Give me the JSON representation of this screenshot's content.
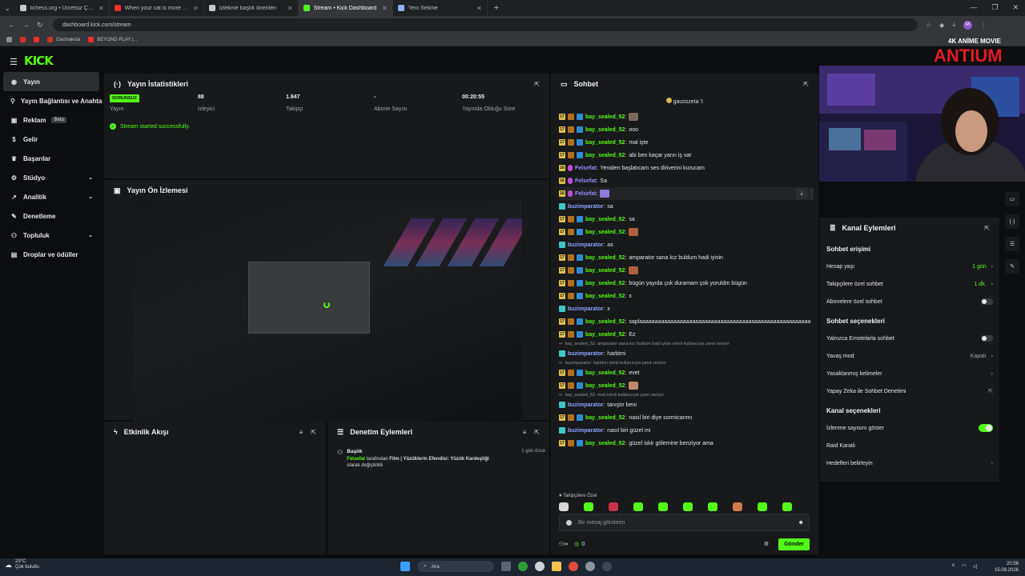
{
  "browser": {
    "tabs": [
      {
        "label": "lichess.org • Ücretsiz Çevrimiçi",
        "color": "#c9c9c9",
        "active": false
      },
      {
        "label": "When your cat is more polite th",
        "color": "#ff2e2e",
        "active": false
      },
      {
        "label": "İzlekme başlık önerileri",
        "color": "#c9c9c9",
        "active": false
      },
      {
        "label": "Stream • Kick Dashboard",
        "color": "#53fc18",
        "active": true
      },
      {
        "label": "Yeni Sekme",
        "color": "#8ab4f8",
        "active": false
      }
    ],
    "url": "dashboard.kick.com/stream",
    "bookmarks": [
      "Gachiakuta",
      "BEYOND PLAY |..."
    ]
  },
  "brand": {
    "logo": "KICK",
    "accent": "#53fc18"
  },
  "sidebar": {
    "items": [
      {
        "label": "Yayın",
        "icon": "broadcast-icon",
        "active": true
      },
      {
        "label": "Yayın Bağlantısı ve Anahtarı",
        "icon": "link-icon"
      },
      {
        "label": "Reklam",
        "icon": "ad-icon",
        "badge": "Beta"
      },
      {
        "label": "Gelir",
        "icon": "money-icon"
      },
      {
        "label": "Başarılar",
        "icon": "trophy-icon"
      },
      {
        "label": "Stüdyo",
        "icon": "studio-icon",
        "expand": true
      },
      {
        "label": "Analitik",
        "icon": "chart-icon",
        "expand": true
      },
      {
        "label": "Denetleme",
        "icon": "wrench-icon"
      },
      {
        "label": "Topluluk",
        "icon": "users-icon",
        "expand": true
      },
      {
        "label": "Droplar ve ödüller",
        "icon": "gift-icon"
      }
    ]
  },
  "stats": {
    "title": "Yayın İstatistikleri",
    "items": [
      {
        "value": "SORUNSUZ",
        "label": "Yayın",
        "badge": true
      },
      {
        "value": "88",
        "label": "İzleyici"
      },
      {
        "value": "1.947",
        "label": "Takipçi"
      },
      {
        "value": "-",
        "label": "Abone Sayısı"
      },
      {
        "value": "00:20:55",
        "label": "Yayında Olduğu Süre"
      }
    ],
    "success": "Stream started successfully."
  },
  "preview": {
    "title": "Yayın Ön İzlemesi"
  },
  "activity": {
    "title": "Etkinlik Akışı"
  },
  "moderation": {
    "title": "Denetim Eylemleri",
    "entry": {
      "heading": "Başlık",
      "time": "1 gün önce",
      "user": "Felsefat",
      "text1": " tarafından ",
      "text2": "Film | ",
      "text3": "Yüzüklerin Efendisi: Yüzük Kardeşliği",
      "text4": "olarak değiştirildi"
    }
  },
  "chat": {
    "title": "Sohbet",
    "pinned_user": "gausszeta",
    "pinned_count": "5",
    "messages": [
      {
        "user": "bay_sealed_52",
        "text": "",
        "type": "sub",
        "emote": "#7a6a5a"
      },
      {
        "user": "bay_sealed_52",
        "text": "ooo",
        "type": "sub"
      },
      {
        "user": "bay_sealed_52",
        "text": "mal işte",
        "type": "sub"
      },
      {
        "user": "bay_sealed_52",
        "text": "abi ben kaçar yarın iş var",
        "type": "sub"
      },
      {
        "user": "Felsefat",
        "text": "Yeniden başlatıcam ses diriverini kurucam",
        "type": "mod"
      },
      {
        "user": "Felsefat",
        "text": "Sa",
        "type": "mod"
      },
      {
        "user": "Felsefat",
        "text": "",
        "type": "mod",
        "emote": "#8e7ad8"
      },
      {
        "user": "buzimparator",
        "text": "sa",
        "type": "vip"
      },
      {
        "user": "bay_sealed_52",
        "text": "sa",
        "type": "sub"
      },
      {
        "user": "bay_sealed_52",
        "text": "",
        "type": "sub",
        "emote": "#b0603a"
      },
      {
        "user": "buzimparator",
        "text": "as",
        "type": "vip"
      },
      {
        "user": "bay_sealed_52",
        "text": "amparator sana kız buldum hadi iyisin",
        "type": "sub"
      },
      {
        "user": "bay_sealed_52",
        "text": "",
        "type": "sub",
        "emote": "#b0603a"
      },
      {
        "user": "bay_sealed_52",
        "text": "bügün yayıda çok duramam çok yoruldm bügün",
        "type": "sub"
      },
      {
        "user": "bay_sealed_52",
        "text": "x",
        "type": "sub"
      },
      {
        "user": "buzimparator",
        "text": "x",
        "type": "vip"
      },
      {
        "user": "bay_sealed_52",
        "text": "saplaaaaaaaaaaaaaaaaaaaaaaaaaaaaaaaaaaaaaaaaaaaaaaaaaaaaaaa",
        "type": "sub"
      },
      {
        "user": "bay_sealed_52",
        "text": "Ez",
        "type": "sub"
      },
      {
        "reply": "bay_sealed_52: amparator sana kız buldum hadi iyisin isimli kullanıcıya yanıt veriyor"
      },
      {
        "user": "buzimparator",
        "text": "harbimi",
        "type": "vip"
      },
      {
        "reply": "buzimparator: harbimi isimli kullanıcıya yanıt veriyor"
      },
      {
        "user": "bay_sealed_52",
        "text": "evet",
        "type": "sub"
      },
      {
        "user": "bay_sealed_52",
        "text": "",
        "type": "sub",
        "emote": "#c08a6a"
      },
      {
        "reply": "bay_sealed_52: evet isimli kullanıcıya yanıt veriyor"
      },
      {
        "user": "buzimparator",
        "text": "tanıştır beni",
        "type": "vip"
      },
      {
        "user": "bay_sealed_52",
        "text": "nasıl biri diye sormicanmı",
        "type": "sub"
      },
      {
        "user": "buzimparator",
        "text": "nasıl biri güzel mi",
        "type": "vip"
      },
      {
        "user": "bay_sealed_52",
        "text": "güzel iskir gölemine benziyor ama",
        "type": "sub"
      }
    ],
    "followers_only_label": "Takipçilere Özel",
    "input_placeholder": "Bir mesaj gönderin",
    "points": "0",
    "send_label": "Gönder"
  },
  "channel": {
    "title": "Kanal Eylemleri",
    "chat_access_title": "Sohbet erişimi",
    "account_age": {
      "label": "Hesap yaşı",
      "value": "1 gün"
    },
    "followers_chat": {
      "label": "Takipçilere özel sohbet",
      "value": "1 dk."
    },
    "subs_chat": {
      "label": "Abonelere özel sohbet",
      "on": false
    },
    "chat_options_title": "Sohbet seçenekleri",
    "emote_only": {
      "label": "Yalnızca Emotelarla sohbet",
      "on": false
    },
    "slow_mode": {
      "label": "Yavaş mod",
      "value": "Kapalı"
    },
    "banned_words": {
      "label": "Yasaklanmış kelimeler"
    },
    "ai_moderation": {
      "label": "Yapay Zeka ile Sohbet Denetimi"
    },
    "channel_options_title": "Kanal seçenekleri",
    "show_viewers": {
      "label": "İzlenme sayısını göster",
      "on": true
    },
    "raid": {
      "label": "Raid Kanalı"
    },
    "targets": {
      "label": "Hedefleri belirleyin"
    }
  },
  "overlay": {
    "top": "4K ANİME MOVIE",
    "brand": "ANTIUM"
  },
  "taskbar": {
    "temp": "23°C",
    "weather": "Çok bulutlu",
    "search": "Ara",
    "time": "20:56",
    "date": "15.08.2026"
  }
}
